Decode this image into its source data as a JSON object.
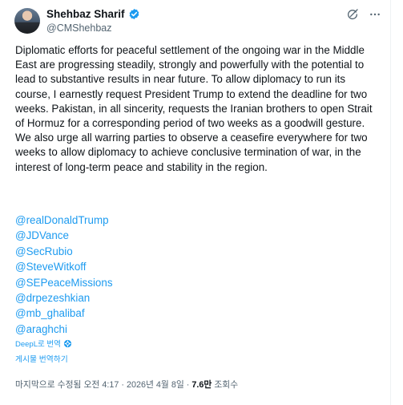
{
  "author": {
    "name": "Shehbaz Sharif",
    "handle": "@CMShehbaz"
  },
  "post": {
    "text": "Diplomatic efforts for peaceful settlement of the ongoing war in the Middle East are progressing steadily, strongly and powerfully with the potential to lead to substantive results in near future. To allow diplomacy to run its course, I earnestly request President Trump to extend the deadline for two weeks. Pakistan, in all sincerity, requests the Iranian brothers to open Strait of Hormuz for a corresponding period of two weeks as a goodwill gesture. We also urge all warring parties to observe a ceasefire everywhere for two weeks to allow diplomacy to achieve conclusive termination of war, in the interest of long-term peace and stability in the region.",
    "mentions": [
      "@realDonaldTrump",
      "@JDVance",
      "@SecRubio",
      "@SteveWitkoff",
      "@SEPeaceMissions",
      "@drpezeshkian",
      "@mb_ghalibaf",
      "@araghchi"
    ]
  },
  "translation": {
    "label": "DeepL로 번역",
    "post_label": "게시물 번역하기"
  },
  "meta": {
    "edited": "마지막으로 수정됨 오전 4:17",
    "date": "2026년 4월 8일",
    "views_count": "7.6만",
    "views_label": "조회수"
  },
  "colors": {
    "link": "#1d9bf0",
    "verified": "#1d9bf0",
    "secondary_text": "#536471"
  },
  "icons": {
    "verified": "verified-badge-icon",
    "grok": "grok-icon",
    "more": "more-options-icon",
    "translate": "translate-gear-icon"
  }
}
